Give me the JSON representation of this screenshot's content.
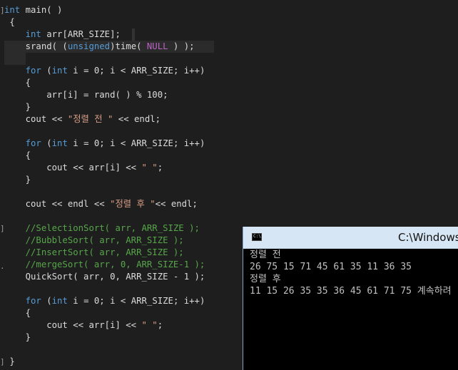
{
  "editor": {
    "lines": [
      {
        "id": "l1",
        "segs": [
          {
            "t": "int",
            "c": "kw"
          },
          {
            "t": " main( )",
            "c": ""
          }
        ]
      },
      {
        "id": "l2",
        "segs": [
          {
            "t": " {",
            "c": ""
          }
        ]
      },
      {
        "id": "l3",
        "segs": [
          {
            "t": "    ",
            "c": ""
          },
          {
            "t": "int",
            "c": "kw"
          },
          {
            "t": " arr[ARR_SIZE];",
            "c": ""
          }
        ]
      },
      {
        "id": "l4",
        "segs": [
          {
            "t": "    srand( (",
            "c": ""
          },
          {
            "t": "unsigned",
            "c": "kw"
          },
          {
            "t": ")time( ",
            "c": ""
          },
          {
            "t": "NULL",
            "c": "mac"
          },
          {
            "t": " ) );",
            "c": ""
          }
        ]
      },
      {
        "id": "l5",
        "segs": []
      },
      {
        "id": "l6",
        "segs": [
          {
            "t": "    ",
            "c": ""
          },
          {
            "t": "for",
            "c": "kw"
          },
          {
            "t": " (",
            "c": ""
          },
          {
            "t": "int",
            "c": "kw"
          },
          {
            "t": " i = 0; i < ARR_SIZE; i++)",
            "c": ""
          }
        ]
      },
      {
        "id": "l7",
        "segs": [
          {
            "t": "    {",
            "c": ""
          }
        ]
      },
      {
        "id": "l8",
        "segs": [
          {
            "t": "        arr[i] = rand( ) % 100;",
            "c": ""
          }
        ]
      },
      {
        "id": "l9",
        "segs": [
          {
            "t": "    }",
            "c": ""
          }
        ]
      },
      {
        "id": "l10",
        "segs": [
          {
            "t": "    cout << ",
            "c": ""
          },
          {
            "t": "\"정렬 전 \"",
            "c": "str"
          },
          {
            "t": " << endl;",
            "c": ""
          }
        ]
      },
      {
        "id": "l11",
        "segs": []
      },
      {
        "id": "l12",
        "segs": [
          {
            "t": "    ",
            "c": ""
          },
          {
            "t": "for",
            "c": "kw"
          },
          {
            "t": " (",
            "c": ""
          },
          {
            "t": "int",
            "c": "kw"
          },
          {
            "t": " i = 0; i < ARR_SIZE; i++)",
            "c": ""
          }
        ]
      },
      {
        "id": "l13",
        "segs": [
          {
            "t": "    {",
            "c": ""
          }
        ]
      },
      {
        "id": "l14",
        "segs": [
          {
            "t": "        cout << arr[i] << ",
            "c": ""
          },
          {
            "t": "\" \"",
            "c": "str"
          },
          {
            "t": ";",
            "c": ""
          }
        ]
      },
      {
        "id": "l15",
        "segs": [
          {
            "t": "    }",
            "c": ""
          }
        ]
      },
      {
        "id": "l16",
        "segs": []
      },
      {
        "id": "l17",
        "segs": [
          {
            "t": "    cout << endl << ",
            "c": ""
          },
          {
            "t": "\"정렬 후 \"",
            "c": "str"
          },
          {
            "t": "<< endl;",
            "c": ""
          }
        ]
      },
      {
        "id": "l18",
        "segs": []
      },
      {
        "id": "l19",
        "segs": [
          {
            "t": "    //SelectionSort( arr, ARR_SIZE );",
            "c": "cmt"
          }
        ]
      },
      {
        "id": "l20",
        "segs": [
          {
            "t": "    //BubbleSort( arr, ARR_SIZE );",
            "c": "cmt"
          }
        ]
      },
      {
        "id": "l21",
        "segs": [
          {
            "t": "    //InsertSort( arr, ARR_SIZE );",
            "c": "cmt"
          }
        ]
      },
      {
        "id": "l22",
        "segs": [
          {
            "t": "    //mergeSort( arr, 0, ARR_SIZE-1 );",
            "c": "cmt"
          }
        ]
      },
      {
        "id": "l23",
        "segs": [
          {
            "t": "    QuickSort( arr, 0, ARR_SIZE - 1 );",
            "c": ""
          }
        ]
      },
      {
        "id": "l24",
        "segs": []
      },
      {
        "id": "l25",
        "segs": [
          {
            "t": "    ",
            "c": ""
          },
          {
            "t": "for",
            "c": "kw"
          },
          {
            "t": " (",
            "c": ""
          },
          {
            "t": "int",
            "c": "kw"
          },
          {
            "t": " i = 0; i < ARR_SIZE; i++)",
            "c": ""
          }
        ]
      },
      {
        "id": "l26",
        "segs": [
          {
            "t": "    {",
            "c": ""
          }
        ]
      },
      {
        "id": "l27",
        "segs": [
          {
            "t": "        cout << arr[i] << ",
            "c": ""
          },
          {
            "t": "\" \"",
            "c": "str"
          },
          {
            "t": ";",
            "c": ""
          }
        ]
      },
      {
        "id": "l28",
        "segs": [
          {
            "t": "    }",
            "c": ""
          }
        ]
      },
      {
        "id": "l29",
        "segs": []
      },
      {
        "id": "l30",
        "segs": [
          {
            "t": " }",
            "c": ""
          }
        ]
      }
    ]
  },
  "console": {
    "icon_label": "C:\\",
    "title": "C:\\Windows",
    "lines": [
      "정렬 전",
      "26 75 15 71 45 61 35 11 36 35",
      "정렬 후",
      "11 15 26 35 35 36 45 61 71 75 계속하려"
    ]
  },
  "colors": {
    "background": "#1e1e1e",
    "keyword": "#569cd6",
    "macro": "#bd63c5",
    "string": "#d69d85",
    "comment": "#57a64a",
    "console_title_bar": "#d7e6f4"
  }
}
